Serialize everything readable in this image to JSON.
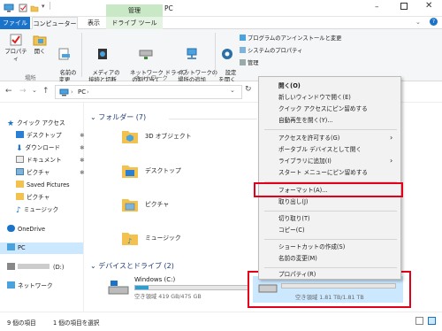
{
  "window": {
    "title": "PC"
  },
  "ribbon_tabs": {
    "file": "ファイル",
    "computer": "コンピューター",
    "view": "表示",
    "manage_label": "管理",
    "drive_tools": "ドライブ ツール"
  },
  "ribbon": {
    "properties": "プロパティ",
    "open": "開く",
    "rename": "名前の\n変更",
    "group_location": "場所",
    "media": "メディアの\n接続と切断",
    "map_drive": "ネットワーク ドライブ\nの割り当て",
    "add_location": "ネットワークの\n場所の追加",
    "group_network": "ネットワーク",
    "settings": "設定\nを開く",
    "uninstall": "プログラムのアンインストールと変更",
    "sys_props": "システムのプロパティ",
    "manage": "管理"
  },
  "address": {
    "path": "PC",
    "search_placeholder": "PCの検索"
  },
  "sidebar": {
    "quick_access": "クイック アクセス",
    "desktop": "デスクトップ",
    "downloads": "ダウンロード",
    "documents": "ドキュメント",
    "pictures": "ピクチャ",
    "saved_pictures": "Saved Pictures",
    "onedrive_folder": "ピクチャ",
    "music": "ミュージック",
    "onedrive": "OneDrive",
    "pc": "PC",
    "drive_d": "(D:)",
    "network": "ネットワーク"
  },
  "content": {
    "folders_header": "フォルダー (7)",
    "folders": [
      "3D オブジェクト",
      "デスクトップ",
      "ピクチャ",
      "ミュージック"
    ],
    "devices_header": "デバイスとドライブ (2)",
    "drive_c_name": "Windows (C:)",
    "drive_c_space": "空き領域 419 GB/475 GB",
    "drive_c_fill": 0.12,
    "drive_d_space": "空き領域 1.81 TB/1.81 TB"
  },
  "context_menu": {
    "items": [
      "開く(O)",
      "新しいウィンドウで開く(E)",
      "クイック アクセスにピン留めする",
      "自動再生を開く(Y)...",
      "アクセスを許可する(G)",
      "ポータブル デバイスとして開く",
      "ライブラリに追加(I)",
      "スタート メニューにピン留めする",
      "フォーマット(A)...",
      "取り出し(J)",
      "切り取り(T)",
      "コピー(C)",
      "ショートカットの作成(S)",
      "名前の変更(M)",
      "プロパティ(R)"
    ]
  },
  "status": {
    "count": "9 個の項目",
    "selected": "1 個の項目を選択"
  },
  "colors": {
    "accent": "#1a73c8",
    "highlight": "#e3001b",
    "manage_tab": "#c9e8c5"
  }
}
